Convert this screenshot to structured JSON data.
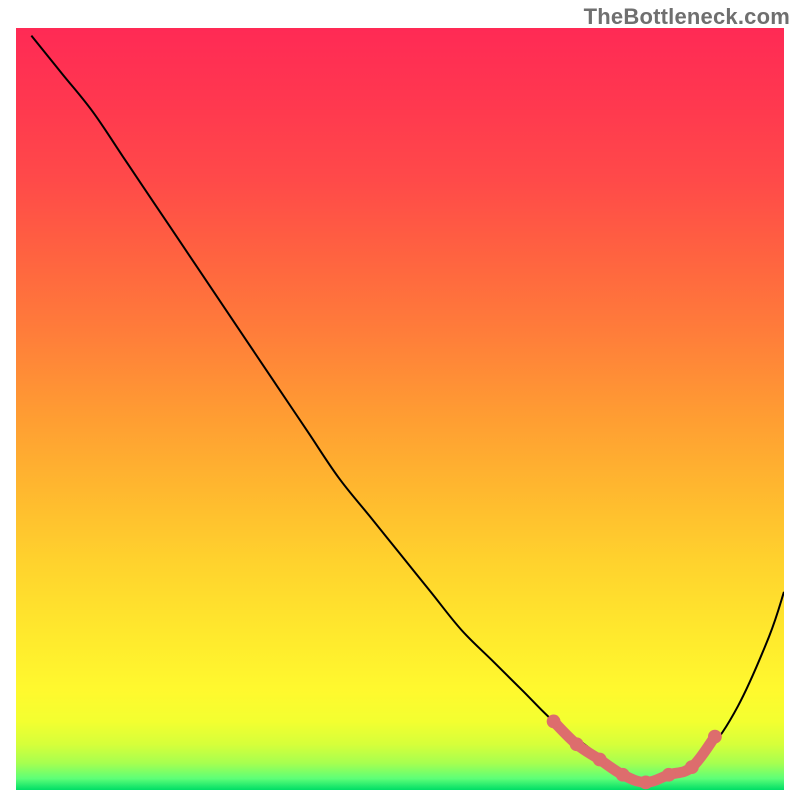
{
  "watermark": "TheBottleneck.com",
  "chart_data": {
    "type": "line",
    "title": "",
    "xlabel": "",
    "ylabel": "",
    "xlim": [
      0,
      100
    ],
    "ylim": [
      0,
      100
    ],
    "series": [
      {
        "name": "curve",
        "x": [
          2,
          6,
          10,
          14,
          18,
          22,
          26,
          30,
          34,
          38,
          42,
          46,
          50,
          54,
          58,
          62,
          66,
          70,
          74,
          78,
          82,
          86,
          90,
          94,
          98,
          100
        ],
        "values": [
          99,
          94,
          89,
          83,
          77,
          71,
          65,
          59,
          53,
          47,
          41,
          36,
          31,
          26,
          21,
          17,
          13,
          9,
          6,
          3,
          1,
          2,
          5,
          11,
          20,
          26
        ]
      }
    ],
    "highlighted_region": {
      "x": [
        70,
        73,
        76,
        79,
        82,
        85,
        88,
        91
      ],
      "values": [
        9,
        6,
        4,
        2,
        1,
        2,
        3,
        7
      ]
    },
    "background_gradient_stops": [
      {
        "offset": 0.0,
        "color": "#ff2a55"
      },
      {
        "offset": 0.1,
        "color": "#ff384f"
      },
      {
        "offset": 0.2,
        "color": "#ff4a49"
      },
      {
        "offset": 0.3,
        "color": "#ff6340"
      },
      {
        "offset": 0.4,
        "color": "#ff7d3a"
      },
      {
        "offset": 0.5,
        "color": "#ff9a33"
      },
      {
        "offset": 0.6,
        "color": "#ffb62f"
      },
      {
        "offset": 0.7,
        "color": "#ffd22d"
      },
      {
        "offset": 0.8,
        "color": "#ffea2d"
      },
      {
        "offset": 0.87,
        "color": "#fff92e"
      },
      {
        "offset": 0.91,
        "color": "#f3ff30"
      },
      {
        "offset": 0.94,
        "color": "#d6ff3a"
      },
      {
        "offset": 0.965,
        "color": "#a6ff50"
      },
      {
        "offset": 0.985,
        "color": "#5dff78"
      },
      {
        "offset": 1.0,
        "color": "#00dd66"
      }
    ],
    "highlight_color": "#dd6d6d",
    "curve_color": "#000000"
  }
}
